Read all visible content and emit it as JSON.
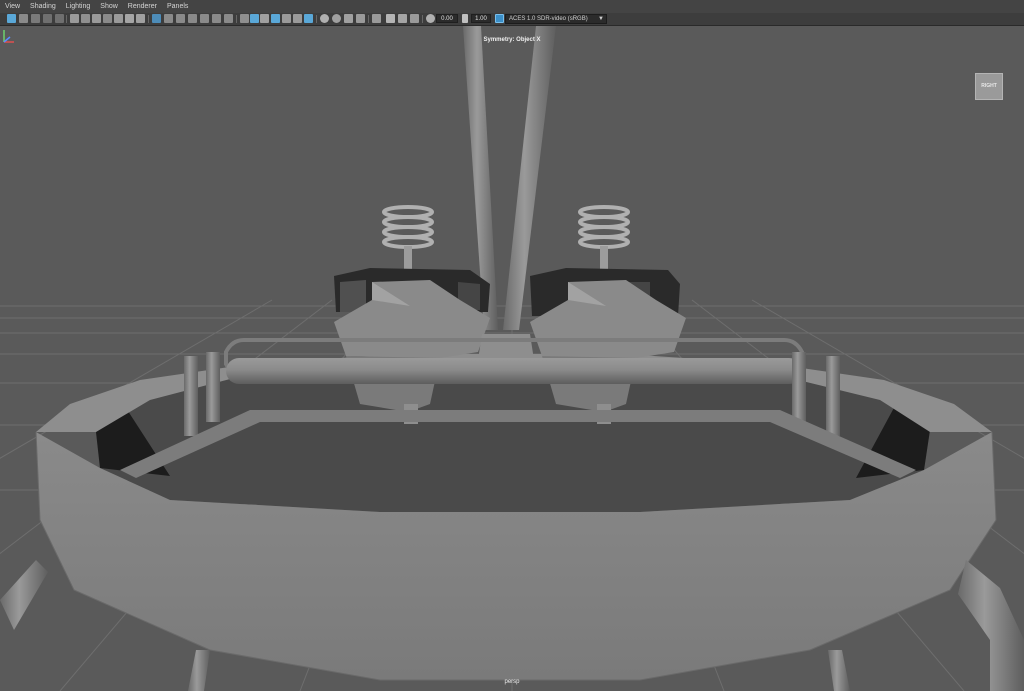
{
  "menubar": {
    "items": [
      "View",
      "Shading",
      "Lighting",
      "Show",
      "Renderer",
      "Panels"
    ]
  },
  "toolbar": {
    "exposure_value": "0.00",
    "gamma_value": "1.00",
    "color_space": "ACES 1.0 SDR-video (sRGB)",
    "icons": [
      "select-camera",
      "camera-attributes",
      "bookmarks",
      "image-plane",
      "grid",
      "film-gate",
      "resolution-gate",
      "gate-mask",
      "field-chart",
      "safe-action",
      "safe-title",
      "wireframe",
      "smooth-shade-all",
      "wireframe-on-shaded",
      "textured",
      "use-all-lights",
      "shadows",
      "screen-space-ao",
      "motion-blur",
      "multisample-aa",
      "depth-of-field",
      "isolate-select",
      "xray",
      "xray-joints",
      "xray-active-components",
      "exposure",
      "gamma",
      "color-management"
    ]
  },
  "viewport": {
    "symmetry_label": "Symmetry: Object X",
    "camera_label": "persp",
    "viewcube_label": "RIGHT",
    "background_color": "#5a5a5a",
    "grid_color": "#6e6e6e"
  }
}
